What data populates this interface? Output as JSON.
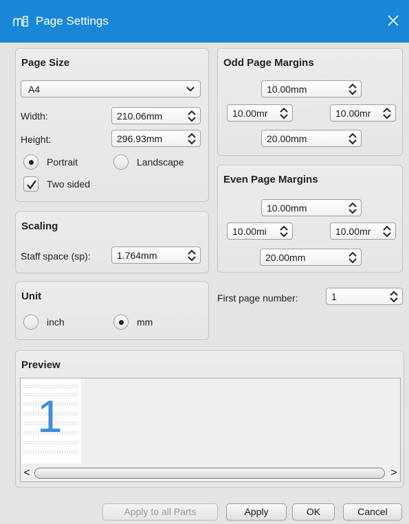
{
  "window": {
    "title": "Page Settings"
  },
  "page_size": {
    "title": "Page Size",
    "paper": "A4",
    "width_label": "Width:",
    "width_value": "210.06mm",
    "height_label": "Height:",
    "height_value": "296.93mm",
    "portrait_label": "Portrait",
    "landscape_label": "Landscape",
    "orientation": "portrait",
    "two_sided_label": "Two sided",
    "two_sided": true
  },
  "scaling": {
    "title": "Scaling",
    "staff_space_label": "Staff space (sp):",
    "staff_space_value": "1.764mm"
  },
  "unit": {
    "title": "Unit",
    "inch_label": "inch",
    "mm_label": "mm",
    "selected": "mm"
  },
  "odd_margins": {
    "title": "Odd Page Margins",
    "top": "10.00mm",
    "left": "10.00mr",
    "right": "10.00mr",
    "bottom": "20.00mm"
  },
  "even_margins": {
    "title": "Even Page Margins",
    "top": "10.00mm",
    "left": "10.00mi",
    "right": "10.00mr",
    "bottom": "20.00mm"
  },
  "first_page": {
    "label": "First page number:",
    "value": "1"
  },
  "preview": {
    "title": "Preview",
    "page_number": "1"
  },
  "buttons": {
    "apply_all": "Apply to all Parts",
    "apply": "Apply",
    "ok": "OK",
    "cancel": "Cancel"
  },
  "colors": {
    "titlebar": "#1a86d6",
    "preview_number": "#3d8fd9"
  }
}
